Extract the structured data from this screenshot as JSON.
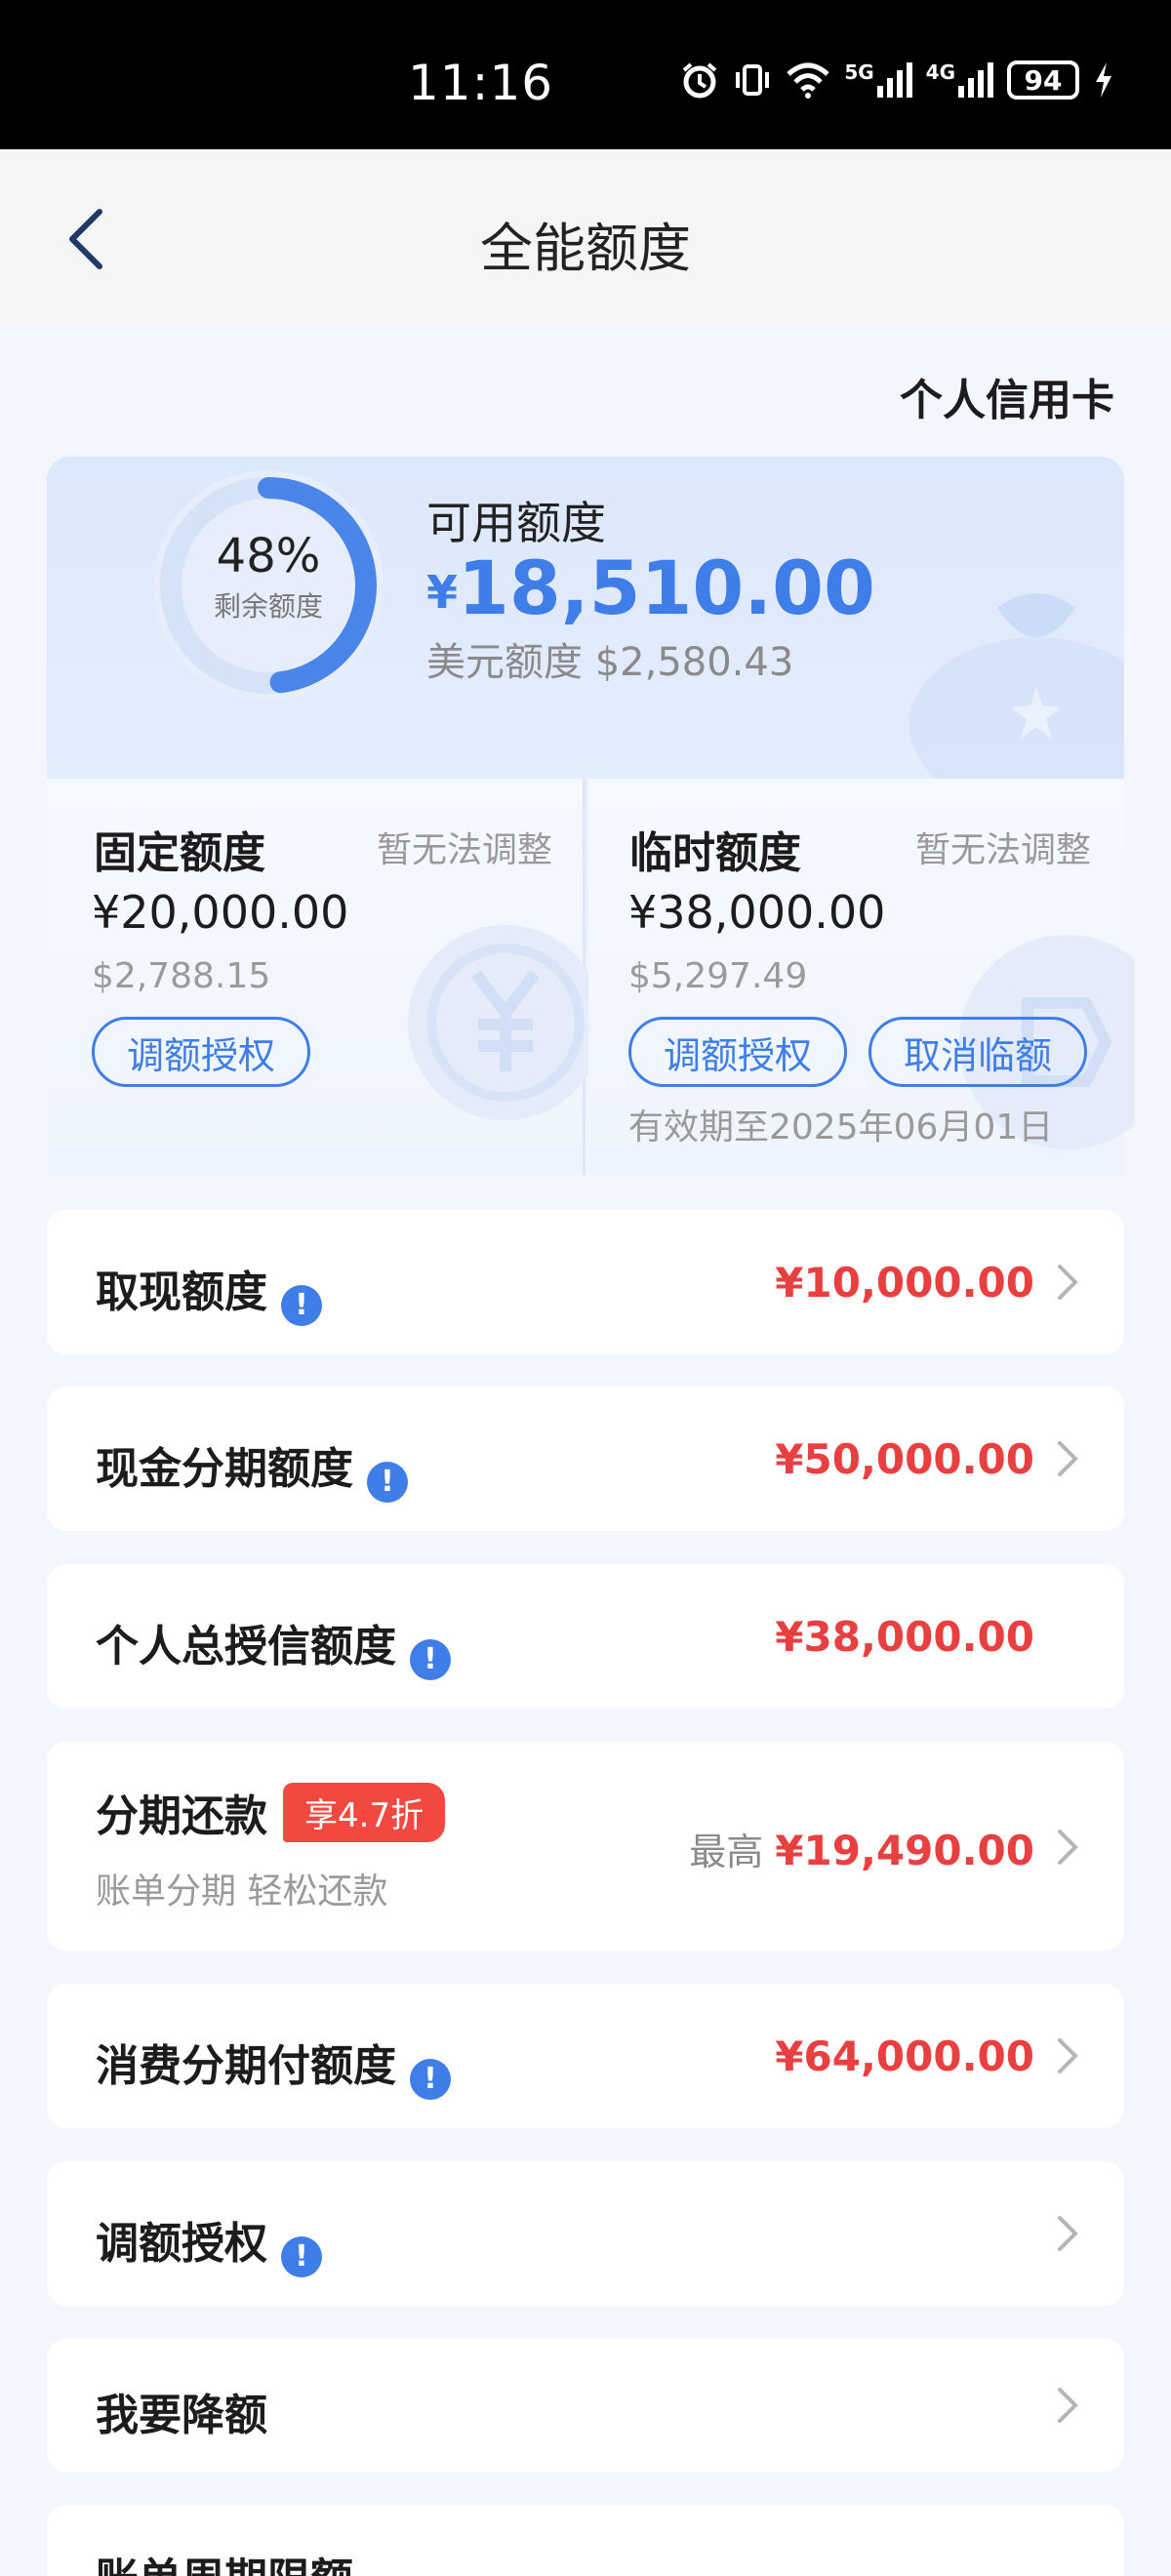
{
  "status_bar": {
    "time": "11:16",
    "net1": "5G",
    "net2": "4G",
    "battery": "94"
  },
  "header": {
    "title": "全能额度"
  },
  "card_type": "个人信用卡",
  "available": {
    "remaining_pct": "48%",
    "remaining_label": "剩余额度",
    "remaining_fraction": 0.48,
    "label": "可用额度",
    "currency": "¥",
    "amount": "18,510.00",
    "usd": "美元额度 $2,580.43"
  },
  "fixed": {
    "title": "固定额度",
    "note": "暂无法调整",
    "amount": "¥20,000.00",
    "usd": "$2,788.15",
    "button": "调额授权"
  },
  "temporary": {
    "title": "临时额度",
    "note": "暂无法调整",
    "amount": "¥38,000.00",
    "usd": "$5,297.49",
    "button1": "调额授权",
    "button2": "取消临额",
    "validity": "有效期至2025年06月01日"
  },
  "rows": {
    "cash": {
      "label": "取现额度",
      "value": "¥10,000.00"
    },
    "cash_installment": {
      "label": "现金分期额度",
      "value": "¥50,000.00"
    },
    "total_credit": {
      "label": "个人总授信额度",
      "value": "¥38,000.00"
    },
    "installment": {
      "label": "分期还款",
      "tag": "享4.7折",
      "sub": "账单分期 轻松还款",
      "prefix": "最高",
      "value": "¥19,490.00"
    },
    "consumer_installment": {
      "label": "消费分期付额度",
      "value": "¥64,000.00"
    },
    "adjust": {
      "label": "调额授权"
    },
    "reduce": {
      "label": "我要降额"
    },
    "bill_cycle": {
      "label": "账单周期限额"
    }
  },
  "colors": {
    "accent": "#3f7ee8",
    "value_red": "#e84040",
    "tag_red": "#f2483f"
  }
}
